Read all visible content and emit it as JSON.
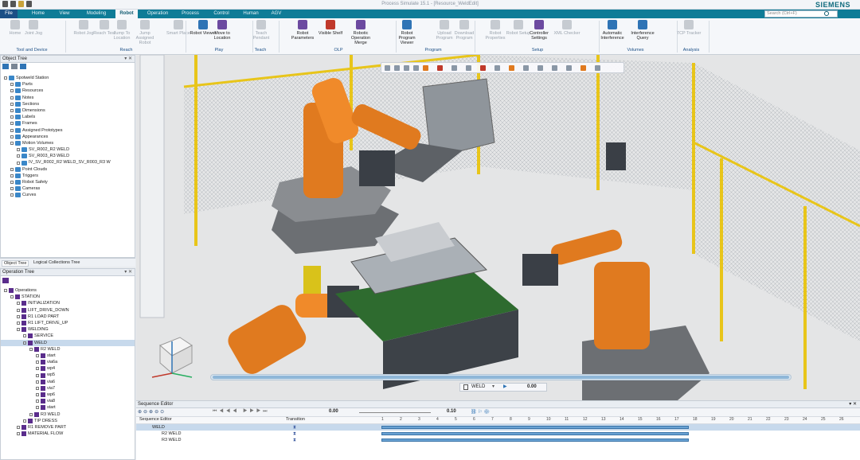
{
  "app": {
    "title": "Process Simulate 15.1 - [Resource_WeldEdit]",
    "brand": "SIEMENS",
    "search_placeholder": "Search (Ctrl+F)"
  },
  "tabs": [
    {
      "label": "File"
    },
    {
      "label": "Home"
    },
    {
      "label": "View"
    },
    {
      "label": "Modeling"
    },
    {
      "label": "Robot"
    },
    {
      "label": "Operation"
    },
    {
      "label": "Process"
    },
    {
      "label": "Control"
    },
    {
      "label": "Human"
    },
    {
      "label": "AGV"
    }
  ],
  "ribbon": {
    "buttons": [
      {
        "label": "Home",
        "icon": "home-icon"
      },
      {
        "label": "Joint Jog",
        "icon": "joint-jog-icon"
      },
      {
        "label": "Robot Jog",
        "icon": "robot-jog-icon"
      },
      {
        "label": "Reach Test",
        "icon": "reach-test-icon"
      },
      {
        "label": "Jump To Location",
        "icon": "jump-location-icon"
      },
      {
        "label": "Jump Assigned Robot",
        "icon": "jump-robot-icon"
      },
      {
        "label": "Smart Place",
        "icon": "smart-place-icon"
      },
      {
        "label": "Robot Viewer",
        "icon": "robot-viewer-icon"
      },
      {
        "label": "Move to Location",
        "icon": "move-location-icon"
      },
      {
        "label": "Teach Pendant",
        "icon": "teach-pendant-icon"
      },
      {
        "label": "Robot Parameters",
        "icon": "robot-parameters-icon"
      },
      {
        "label": "Visible Shelf",
        "icon": "visible-shelf-icon"
      },
      {
        "label": "Robotic Operation Merge",
        "icon": "operation-merge-icon"
      },
      {
        "label": "Robot Program Viewer",
        "icon": "program-viewer-icon"
      },
      {
        "label": "Upload Program",
        "icon": "upload-program-icon"
      },
      {
        "label": "Download Program",
        "icon": "download-program-icon"
      },
      {
        "label": "Robot Properties",
        "icon": "robot-properties-icon"
      },
      {
        "label": "Robot Setup",
        "icon": "robot-setup-icon"
      },
      {
        "label": "Controller Settings",
        "icon": "controller-settings-icon"
      },
      {
        "label": "XML Checker",
        "icon": "xml-checker-icon"
      },
      {
        "label": "Automatic Interference",
        "icon": "auto-interference-icon"
      },
      {
        "label": "Interference Query",
        "icon": "interference-query-icon"
      },
      {
        "label": "TCP Tracker",
        "icon": "tcp-tracker-icon"
      }
    ],
    "groups": [
      "Tool and Device",
      "Reach",
      "Play",
      "Teach",
      "OLP",
      "Program",
      "Setup",
      "Volumes",
      "Analysis"
    ]
  },
  "object_tree": {
    "title": "Object Tree",
    "items": [
      {
        "label": "Spotweld Station",
        "level": 0
      },
      {
        "label": "Parts",
        "level": 1
      },
      {
        "label": "Resources",
        "level": 1
      },
      {
        "label": "Notes",
        "level": 1
      },
      {
        "label": "Sections",
        "level": 1
      },
      {
        "label": "Dimensions",
        "level": 1
      },
      {
        "label": "Labels",
        "level": 1
      },
      {
        "label": "Frames",
        "level": 1
      },
      {
        "label": "Assigned Prototypes",
        "level": 1
      },
      {
        "label": "Appearances",
        "level": 1
      },
      {
        "label": "Motion Volumes",
        "level": 1
      },
      {
        "label": "SV_R002_R2 WELD",
        "level": 2
      },
      {
        "label": "SV_R003_R3 WELD",
        "level": 2
      },
      {
        "label": "IV_SV_R002_R2 WELD_SV_R003_R3 W",
        "level": 2
      },
      {
        "label": "Point Clouds",
        "level": 1
      },
      {
        "label": "Triggers",
        "level": 1
      },
      {
        "label": "Robot Safety",
        "level": 1
      },
      {
        "label": "Cameras",
        "level": 1
      },
      {
        "label": "Curves",
        "level": 1
      }
    ]
  },
  "bottom_tabs": [
    "Object Tree",
    "Logical Collections Tree"
  ],
  "operation_tree": {
    "title": "Operation Tree",
    "items": [
      {
        "label": "Operations",
        "level": 0
      },
      {
        "label": "STATION",
        "level": 1
      },
      {
        "label": "INITIALIZATION",
        "level": 2
      },
      {
        "label": "LIFT_DRIVE_DOWN",
        "level": 2
      },
      {
        "label": "R1 LOAD PART",
        "level": 2
      },
      {
        "label": "R1 LIFT_DRIVE_UP",
        "level": 2
      },
      {
        "label": "WELDING",
        "level": 2
      },
      {
        "label": "SERVICE",
        "level": 3
      },
      {
        "label": "WELD",
        "level": 3
      },
      {
        "label": "R2 WELD",
        "level": 4
      },
      {
        "label": "start",
        "level": 5
      },
      {
        "label": "via6a",
        "level": 5
      },
      {
        "label": "wp4",
        "level": 5
      },
      {
        "label": "wp5",
        "level": 5
      },
      {
        "label": "via6",
        "level": 5
      },
      {
        "label": "via7",
        "level": 5
      },
      {
        "label": "wp6",
        "level": 5
      },
      {
        "label": "via8",
        "level": 5
      },
      {
        "label": "start",
        "level": 5
      },
      {
        "label": "R3 WELD",
        "level": 4
      },
      {
        "label": "TIP DRESS",
        "level": 3
      },
      {
        "label": "R1 REMOVE PART",
        "level": 2
      },
      {
        "label": "MATERIAL FLOW",
        "level": 2
      }
    ]
  },
  "playback": {
    "operation": "WELD",
    "time": "0.00"
  },
  "sequence_editor": {
    "title": "Sequence Editor",
    "time": "0.00",
    "step": "0.10",
    "columns": [
      "Sequence Editor",
      "Transition"
    ],
    "rows": [
      {
        "label": "WELD"
      },
      {
        "label": "R2 WELD"
      },
      {
        "label": "R3 WELD"
      }
    ],
    "ticks": [
      "1",
      "2",
      "3",
      "4",
      "5",
      "6",
      "7",
      "8",
      "9",
      "10",
      "11",
      "12",
      "13",
      "14",
      "15",
      "16",
      "17",
      "18",
      "19",
      "20",
      "21",
      "22",
      "23",
      "24",
      "25",
      "26"
    ]
  }
}
